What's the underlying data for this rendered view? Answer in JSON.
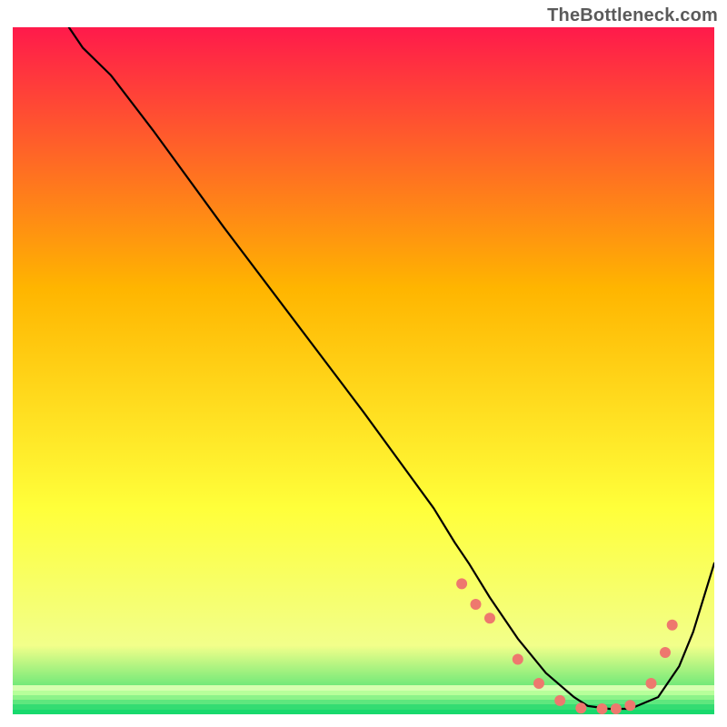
{
  "watermark": "TheBottleneck.com",
  "chart_data": {
    "type": "line",
    "title": "",
    "xlabel": "",
    "ylabel": "",
    "xlim": [
      0,
      100
    ],
    "ylim": [
      0,
      100
    ],
    "grid": false,
    "legend": false,
    "gradient_colors": {
      "top": "#ff1a4b",
      "mid_upper": "#ffb500",
      "mid_lower": "#ffff3a",
      "lower_band": "#f2ff8a",
      "bottom": "#17d96d"
    },
    "series": [
      {
        "name": "curve",
        "color": "#000000",
        "x": [
          8,
          10,
          14,
          20,
          30,
          40,
          50,
          60,
          63,
          65,
          68,
          72,
          76,
          80,
          82,
          85,
          88,
          92,
          95,
          97,
          100
        ],
        "y": [
          100,
          97,
          93,
          85,
          71,
          57.5,
          44,
          30,
          25,
          22,
          17,
          11,
          6,
          2.5,
          1.2,
          0.8,
          0.8,
          2.5,
          7,
          12,
          22
        ]
      },
      {
        "name": "dotted-band",
        "color": "#ee786e",
        "x": [
          64,
          66,
          68,
          72,
          75,
          78,
          81,
          84,
          86,
          88,
          91,
          93,
          94
        ],
        "y": [
          19,
          16,
          14,
          8,
          4.5,
          2,
          0.9,
          0.8,
          0.8,
          1.3,
          4.5,
          9,
          13
        ]
      }
    ]
  }
}
